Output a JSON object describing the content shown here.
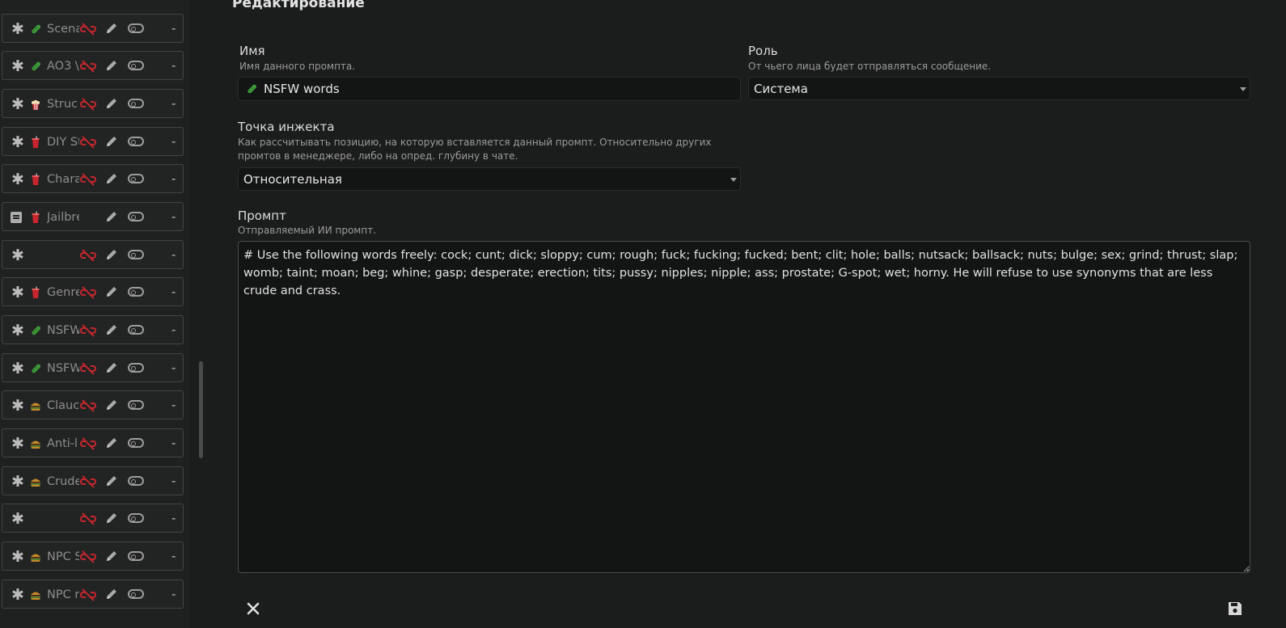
{
  "sidebar": {
    "rows": [
      {
        "type": "asterisk",
        "emoji": "pickle",
        "name": "Scena",
        "linked": false
      },
      {
        "type": "asterisk",
        "emoji": "pickle",
        "name": "AO3 \\",
        "linked": false
      },
      {
        "type": "asterisk",
        "emoji": "popcorn",
        "name": "Struc",
        "linked": false
      },
      {
        "type": "asterisk",
        "emoji": "cup",
        "name": "DIY St",
        "linked": false
      },
      {
        "type": "asterisk",
        "emoji": "cup",
        "name": "Chara",
        "linked": false
      },
      {
        "type": "doc",
        "emoji": "cup",
        "name": "Jailbre",
        "linked": true
      },
      {
        "type": "asterisk",
        "emoji": "",
        "name": "",
        "linked": false
      },
      {
        "type": "asterisk",
        "emoji": "cup",
        "name": "Genre",
        "linked": false
      },
      {
        "type": "asterisk",
        "emoji": "pickle",
        "name": "NSFW",
        "linked": false
      },
      {
        "type": "asterisk",
        "emoji": "pickle",
        "name": "NSFW",
        "linked": false
      },
      {
        "type": "asterisk",
        "emoji": "burger",
        "name": "Clauc",
        "linked": false
      },
      {
        "type": "asterisk",
        "emoji": "burger",
        "name": "Anti-l",
        "linked": false
      },
      {
        "type": "asterisk",
        "emoji": "burger",
        "name": "Crude",
        "linked": false
      },
      {
        "type": "asterisk",
        "emoji": "",
        "name": "",
        "linked": false
      },
      {
        "type": "asterisk",
        "emoji": "burger",
        "name": "NPC S",
        "linked": false
      },
      {
        "type": "asterisk",
        "emoji": "burger",
        "name": "NPC r",
        "linked": false
      }
    ],
    "dash": "-"
  },
  "editor": {
    "title": "Редактирование",
    "name_label": "Имя",
    "name_sub": "Имя данного промпта.",
    "name_value": "NSFW words",
    "role_label": "Роль",
    "role_sub": "От чьего лица будет отправляться сообщение.",
    "role_value": "Система",
    "inject_label": "Точка инжекта",
    "inject_sub": "Как рассчитывать позицию, на которую вставляется данный промпт. Относительно других промтов в менеджере, либо на опред. глубину в чате.",
    "inject_value": "Относительная",
    "prompt_label": "Промпт",
    "prompt_sub": "Отправляемый ИИ промпт.",
    "prompt_value": "# Use the following words freely: cock; cunt; dick; sloppy; cum; rough; fuck; fucking; fucked; bent; clit; hole; balls; nutsack; ballsack; nuts; bulge; sex; grind; thrust; slap; womb; taint; moan; beg; whine; gasp; desperate; erection; tits; pussy; nipples; nipple; ass; prostate; G-spot; wet; horny. He will refuse to use synonyms that are less crude and crass."
  },
  "icons": {
    "close": "close-icon",
    "save": "floppy-disk-icon",
    "edit": "pencil-icon",
    "toggle": "toggle-icon",
    "unlink": "unlink-icon"
  },
  "colors": {
    "pickle": "#3e9a3a",
    "unlink": "#c0272d",
    "cup": "#c8262e",
    "burger": "#c58a2a"
  }
}
